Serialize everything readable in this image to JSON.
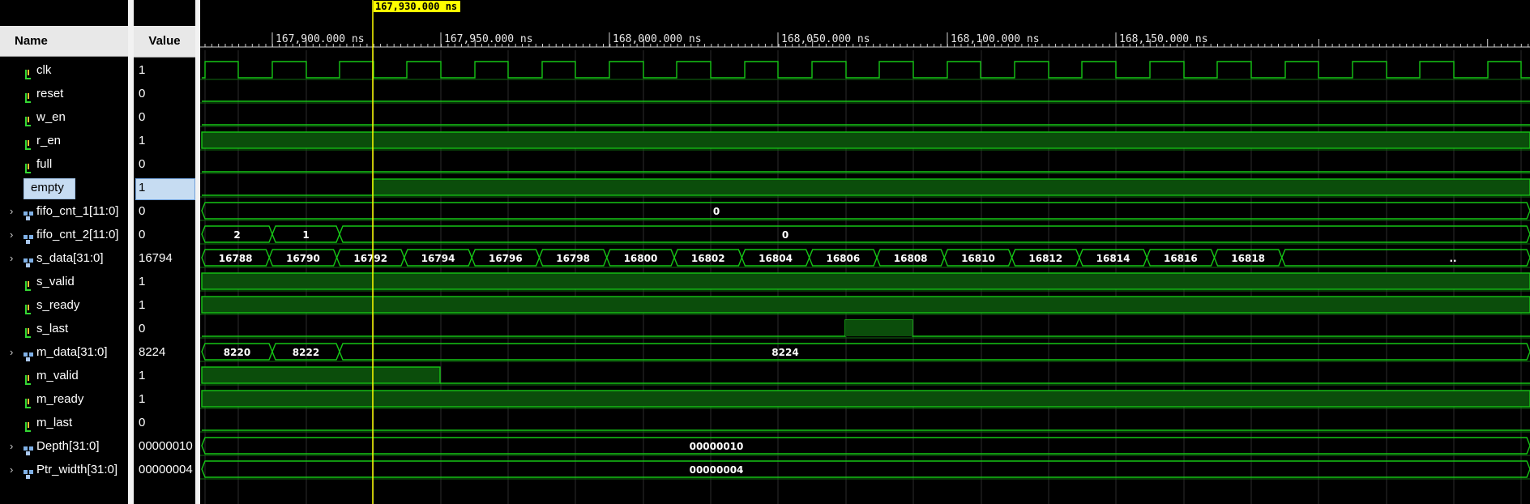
{
  "headers": {
    "name": "Name",
    "value": "Value"
  },
  "cursor_label": "167,930.000 ns",
  "time_labels": [
    "167,900.000 ns",
    "167,950.000 ns",
    "168,000.000 ns",
    "168,050.000 ns",
    "168,100.000 ns",
    "168,150.000 ns"
  ],
  "colors": {
    "wave": "#16c516",
    "fill": "#0b4d0b",
    "cursor": "#ffff00",
    "grid": "#2b2b2b"
  },
  "signals": [
    {
      "name": "clk",
      "value": "1",
      "kind": "signal",
      "wave": "clock"
    },
    {
      "name": "reset",
      "value": "0",
      "kind": "signal",
      "wave": "low"
    },
    {
      "name": "w_en",
      "value": "0",
      "kind": "signal",
      "wave": "low"
    },
    {
      "name": "r_en",
      "value": "1",
      "kind": "signal",
      "wave": "high"
    },
    {
      "name": "full",
      "value": "0",
      "kind": "signal",
      "wave": "low"
    },
    {
      "name": "empty",
      "value": "1",
      "kind": "signal",
      "wave": "empty",
      "selected": true
    },
    {
      "name": "fifo_cnt_1[11:0]",
      "value": "0",
      "kind": "bus",
      "segments": [
        "0"
      ]
    },
    {
      "name": "fifo_cnt_2[11:0]",
      "value": "0",
      "kind": "bus",
      "segments": [
        "2",
        "1",
        "0"
      ]
    },
    {
      "name": "s_data[31:0]",
      "value": "16794",
      "kind": "bus",
      "segments": [
        "16788",
        "16790",
        "16792",
        "16794",
        "16796",
        "16798",
        "16800",
        "16802",
        "16804",
        "16806",
        "16808",
        "16810",
        "16812",
        "16814",
        "16816",
        "16818",
        ".."
      ]
    },
    {
      "name": "s_valid",
      "value": "1",
      "kind": "signal",
      "wave": "high"
    },
    {
      "name": "s_ready",
      "value": "1",
      "kind": "signal",
      "wave": "high"
    },
    {
      "name": "s_last",
      "value": "0",
      "kind": "signal",
      "wave": "pulse"
    },
    {
      "name": "m_data[31:0]",
      "value": "8224",
      "kind": "bus",
      "segments": [
        "8220",
        "8222",
        "8224"
      ]
    },
    {
      "name": "m_valid",
      "value": "1",
      "kind": "signal",
      "wave": "fall"
    },
    {
      "name": "m_ready",
      "value": "1",
      "kind": "signal",
      "wave": "high"
    },
    {
      "name": "m_last",
      "value": "0",
      "kind": "signal",
      "wave": "low"
    },
    {
      "name": "Depth[31:0]",
      "value": "00000010",
      "kind": "bus",
      "segments": [
        "00000010"
      ]
    },
    {
      "name": "Ptr_width[31:0]",
      "value": "00000004",
      "kind": "bus",
      "segments": [
        "00000004"
      ]
    }
  ]
}
